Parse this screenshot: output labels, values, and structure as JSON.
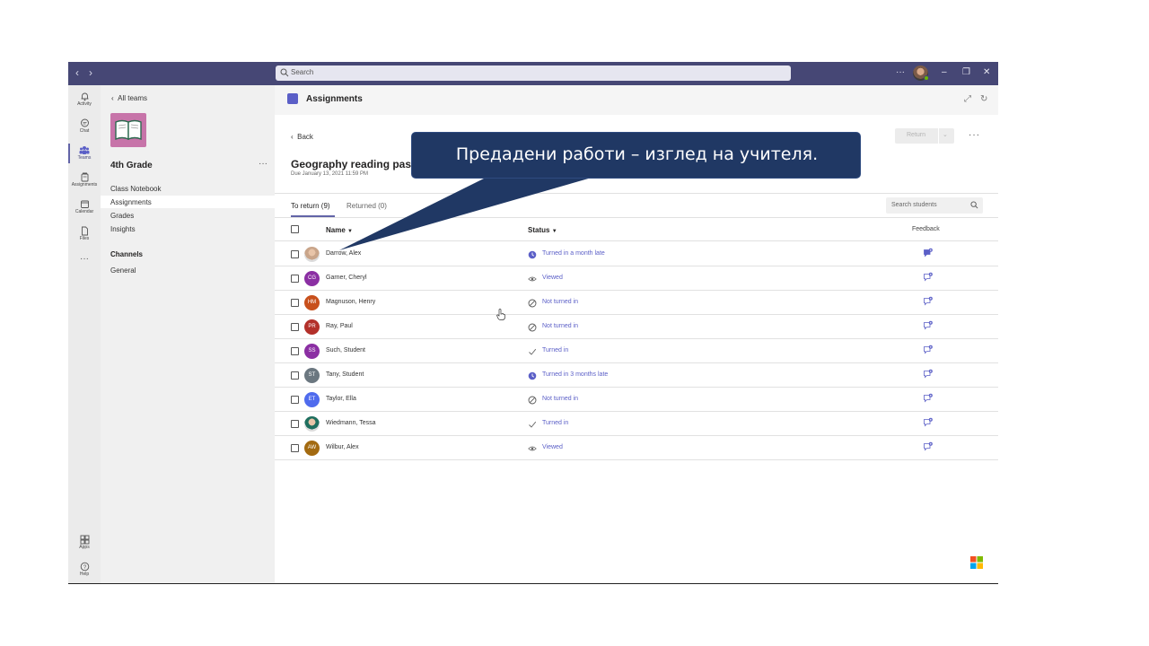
{
  "titlebar": {
    "back_icon": "chevron-left-icon",
    "forward_icon": "chevron-right-icon",
    "search_placeholder": "Search",
    "more_label": "···",
    "minimize_label": "–",
    "restore_label": "❐",
    "close_label": "✕",
    "bar_color": "#464775"
  },
  "rail": {
    "items": [
      {
        "label": "Activity",
        "icon": "bell-icon"
      },
      {
        "label": "Chat",
        "icon": "chat-icon"
      },
      {
        "label": "Teams",
        "icon": "teams-icon"
      },
      {
        "label": "Assignments",
        "icon": "assignments-icon"
      },
      {
        "label": "Calendar",
        "icon": "calendar-icon"
      },
      {
        "label": "Files",
        "icon": "files-icon"
      },
      {
        "label": "···",
        "icon": "more-icon"
      },
      {
        "label": "Apps",
        "icon": "apps-icon"
      },
      {
        "label": "Help",
        "icon": "help-icon"
      }
    ],
    "active": "Teams"
  },
  "sidebar": {
    "back_label": "All teams",
    "team_name": "4th Grade",
    "team_more": "···",
    "team_tile_color": "#c774a9",
    "links": [
      "Class Notebook",
      "Assignments",
      "Grades",
      "Insights"
    ],
    "selected_link": "Assignments",
    "channels_header": "Channels",
    "channels": [
      "General"
    ]
  },
  "header": {
    "title": "Assignments",
    "expand_icon": "expand-icon",
    "refresh_icon": "refresh-icon"
  },
  "assignment": {
    "back_label": "Back",
    "return_label": "Return",
    "more_label": "···",
    "title": "Geography reading pas",
    "due": "Due January 13, 2021 11:59 PM"
  },
  "tabs": {
    "to_return": "To return (9)",
    "returned": "Returned (0)",
    "search_placeholder": "Search students"
  },
  "table": {
    "columns": {
      "name": "Name",
      "status": "Status",
      "feedback": "Feedback"
    },
    "rows": [
      {
        "name": "Darrow, Alex",
        "initials": "",
        "avatar_color": "#c9a58a",
        "status": "Turned in a month late",
        "status_icon": "clock-icon"
      },
      {
        "name": "Garner, Cheryl",
        "initials": "CG",
        "avatar_color": "#8b2fa3",
        "status": "Viewed",
        "status_icon": "eye-icon"
      },
      {
        "name": "Magnuson, Henry",
        "initials": "HM",
        "avatar_color": "#c8501c",
        "status": "Not turned in",
        "status_icon": "not-turned-in-icon"
      },
      {
        "name": "Ray, Paul",
        "initials": "PR",
        "avatar_color": "#b3302a",
        "status": "Not turned in",
        "status_icon": "not-turned-in-icon"
      },
      {
        "name": "Such, Student",
        "initials": "SS",
        "avatar_color": "#8b2fa3",
        "status": "Turned in",
        "status_icon": "check-icon"
      },
      {
        "name": "Tany, Student",
        "initials": "ST",
        "avatar_color": "#6b7780",
        "status": "Turned in 3 months late",
        "status_icon": "clock-icon"
      },
      {
        "name": "Taylor, Ella",
        "initials": "ET",
        "avatar_color": "#4f6bed",
        "status": "Not turned in",
        "status_icon": "not-turned-in-icon"
      },
      {
        "name": "Wiedmann, Tessa",
        "initials": "",
        "avatar_color": "#1f6f5f",
        "status": "Turned in",
        "status_icon": "check-icon"
      },
      {
        "name": "Wilbur, Alex",
        "initials": "AW",
        "avatar_color": "#a36a10",
        "status": "Viewed",
        "status_icon": "eye-icon"
      }
    ]
  },
  "callout": {
    "text": "Предадени работи – изглед на учителя.",
    "color": "#203864"
  },
  "accent_color": "#6264a7"
}
